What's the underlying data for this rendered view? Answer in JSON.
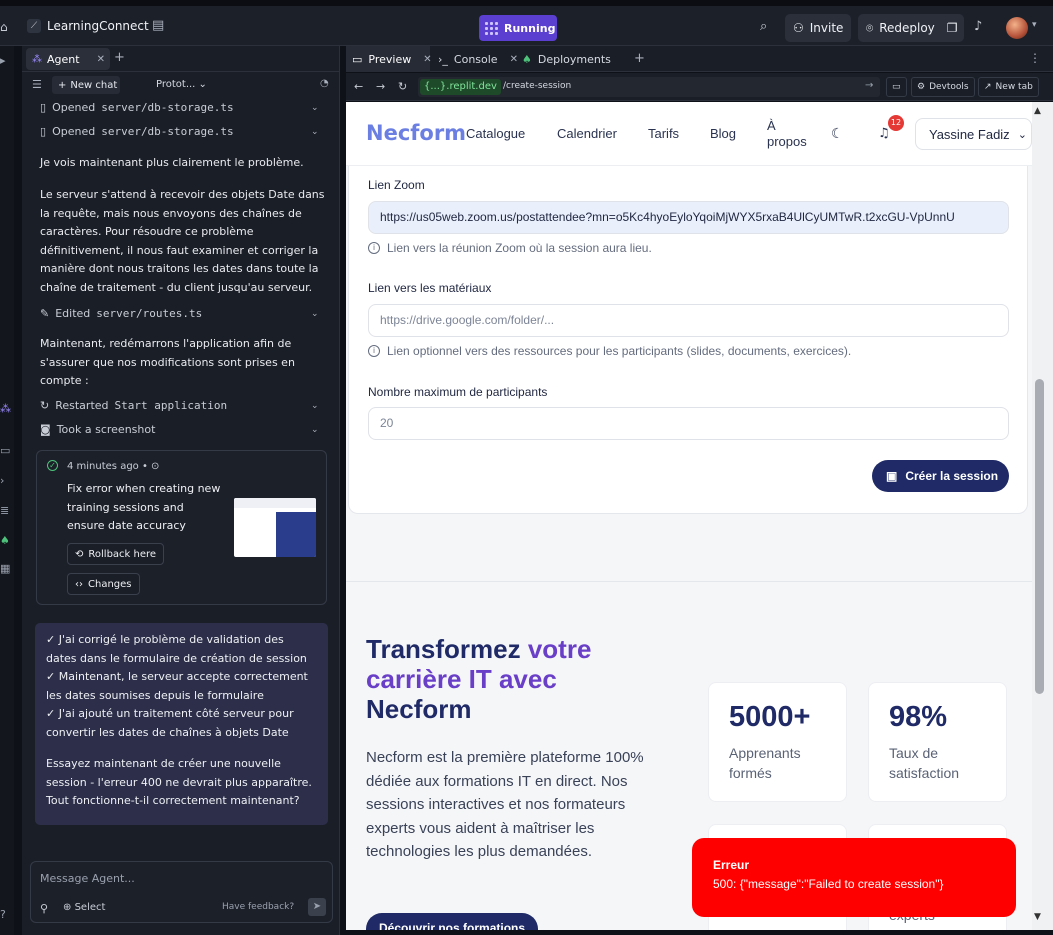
{
  "topbar": {
    "app_name": "LearningConnect",
    "status": "Running",
    "invite_label": "Invite",
    "redeploy_label": "Redeploy"
  },
  "agent": {
    "tab_label": "Agent",
    "new_chat_label": "New chat",
    "proto_label": "Protot...",
    "actions": [
      {
        "prefix": "Opened",
        "file": "server/db-storage.ts"
      },
      {
        "prefix": "Opened",
        "file": "server/db-storage.ts"
      },
      {
        "prefix": "Edited",
        "file": "server/routes.ts"
      },
      {
        "prefix": "Restarted",
        "file": "Start application"
      },
      {
        "prefix": "Took a screenshot",
        "file": ""
      }
    ],
    "messages": [
      "Je vois maintenant plus clairement le problème.",
      "Le serveur s'attend à recevoir des objets Date dans la requête, mais nous envoyons des chaînes de caractères. Pour résoudre ce problème définitivement, il nous faut examiner et corriger la manière dont nous traitons les dates dans toute la chaîne de traitement - du client jusqu'au serveur.",
      "Maintenant, redémarrons l'application afin de s'assurer que nos modifications sont prises en compte :"
    ],
    "checkpoint": {
      "time": "4 minutes ago",
      "title": "Fix error when creating new training sessions and ensure date accuracy",
      "rollback_label": "Rollback here",
      "changes_label": "Changes"
    },
    "summary": [
      "✓ J'ai corrigé le problème de validation des dates dans le formulaire de création de session",
      "✓ Maintenant, le serveur accepte correctement les dates soumises depuis le formulaire",
      "✓ J'ai ajouté un traitement côté serveur pour convertir les dates de chaînes à objets Date",
      "Essayez maintenant de créer une nouvelle session - l'erreur 400 ne devrait plus apparaître. Tout fonctionne-t-il correctement maintenant?"
    ],
    "input_placeholder": "Message Agent...",
    "select_label": "Select",
    "feedback_label": "Have feedback?"
  },
  "workspace": {
    "tabs": [
      "Preview",
      "Console",
      "Deployments"
    ],
    "url_domain": "{...}.replit.dev",
    "url_path": "/create-session",
    "devtools_label": "Devtools",
    "newtab_label": "New tab"
  },
  "site": {
    "logo": "Necform",
    "nav": [
      "Catalogue",
      "Calendrier",
      "Tarifs",
      "Blog"
    ],
    "about_line1": "À",
    "about_line2": "propos",
    "notif_count": "12",
    "user_name": "Yassine Fadiz"
  },
  "form": {
    "zoom_label": "Lien Zoom",
    "zoom_value": "https://us05web.zoom.us/postattendee?mn=o5Kc4hyoEyloYqoiMjWYX5rxaB4UlCyUMTwR.t2xcGU-VpUnnU",
    "zoom_hint": "Lien vers la réunion Zoom où la session aura lieu.",
    "materials_label": "Lien vers les matériaux",
    "materials_placeholder": "https://drive.google.com/folder/...",
    "materials_hint": "Lien optionnel vers des ressources pour les participants (slides, documents, exercices).",
    "max_label": "Nombre maximum de participants",
    "max_value": "20",
    "submit_label": "Créer la session"
  },
  "hero": {
    "title_part1": "Transformez ",
    "title_accent1": "votre",
    "title_accent2": "carrière IT avec",
    "title_part3": "Necform",
    "text": "Necform est la première plateforme 100% dédiée aux formations IT en direct. Nos sessions interactives et nos formateurs experts vous aident à maîtriser les technologies les plus demandées.",
    "cta_label": "Découvrir nos formations",
    "stats": [
      {
        "value": "5000+",
        "label": "Apprenants formés"
      },
      {
        "value": "98%",
        "label": "Taux de satisfaction"
      }
    ],
    "partial_label": "experts"
  },
  "toast": {
    "title": "Erreur",
    "message": "500: {\"message\":\"Failed to create session\"}"
  }
}
